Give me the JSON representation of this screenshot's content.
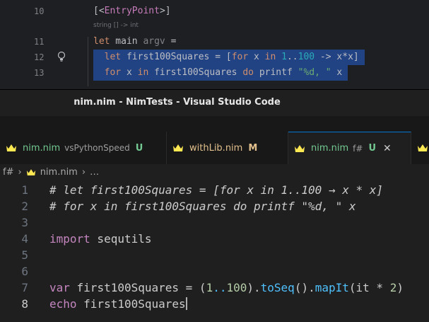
{
  "rider": {
    "lines": [
      {
        "num": "10",
        "code": "[<EntryPoint>]"
      },
      {
        "num": "11",
        "code": "let main argv ="
      },
      {
        "num": "12",
        "code": "  let first100Squares = [for x in 1..100 -> x*x]"
      },
      {
        "num": "13",
        "code": "  for x in first100Squares do printf \"%d, \" x"
      }
    ],
    "inlay_hint": "string [] -> int"
  },
  "window": {
    "title": "nim.nim - NimTests - Visual Studio Code"
  },
  "tabs": [
    {
      "name": "nim.nim",
      "desc": "vsPythonSpeed",
      "flag": "U",
      "active": false
    },
    {
      "name": "withLib.nim",
      "desc": "",
      "flag": "M",
      "active": false
    },
    {
      "name": "nim.nim",
      "desc": "f#",
      "flag": "U",
      "active": true,
      "close": "✕"
    }
  ],
  "breadcrumb": {
    "root": "f#",
    "file": "nim.nim",
    "more": "…"
  },
  "editor": {
    "lines": [
      {
        "num": "1",
        "text": "# let first100Squares = [for x in 1..100 → x * x]"
      },
      {
        "num": "2",
        "text": "# for x in first100Squares do printf \"%d, \" x"
      },
      {
        "num": "3",
        "text": ""
      },
      {
        "num": "4",
        "kw": "import",
        "rest": " sequtils"
      },
      {
        "num": "5",
        "text": ""
      },
      {
        "num": "6",
        "text": ""
      },
      {
        "num": "7",
        "kw": "var",
        "a": " first100Squares = (",
        "n1": "1",
        "dots": "..",
        "n2": "100",
        "b": ").",
        "f1": "toSeq",
        "c": "().",
        "f2": "mapIt",
        "d": "(it * ",
        "n3": "2",
        "e": ")"
      },
      {
        "num": "8",
        "kw": "echo",
        "rest": " first100Squares"
      }
    ]
  },
  "colors": {
    "accent": "#0078d4",
    "untracked": "#73c991",
    "modified": "#e2c08d",
    "selection": "#214283"
  }
}
